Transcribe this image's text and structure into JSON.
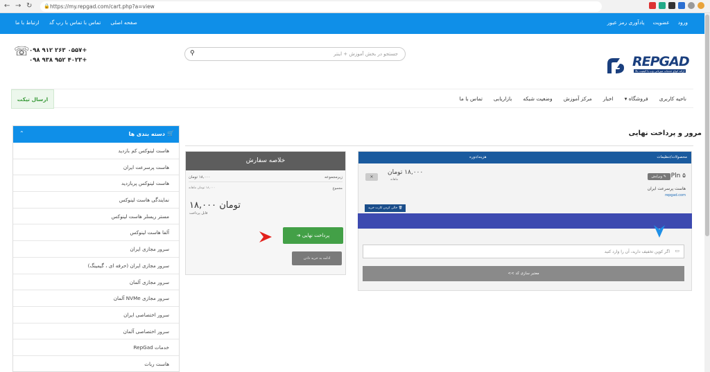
{
  "browser": {
    "url": "https://my.repgad.com/cart.php?a=view"
  },
  "topbar": {
    "left_links": [
      "صفحه اصلی",
      "تماس با تماس با رپ گد",
      "ارتباط با ما"
    ],
    "right_links": [
      "ورود",
      "عضویت",
      "یادآوری رمز عبور"
    ]
  },
  "header": {
    "phone1": "۰۹۸ ۹۱۲ ۲۶۳ ۰۵۵۷+",
    "phone2": "۰۹۸ ۹۳۸ ۹۵۲ ۴۰۲۳+",
    "search_placeholder": "جستجو در بخش آموزش + اینتر",
    "logo_text": "REPGAD",
    "logo_tagline": "ارائه انواع خدمات میزبانی وب با کیفیت بالا"
  },
  "menu": {
    "ticket": "ارسال تیکت",
    "items": [
      "ناحیه کاربری",
      "فروشگاه",
      "اخبار",
      "مرکز آموزش",
      "وضعیت شبکه",
      "بازاریابی",
      "تماس با ما"
    ]
  },
  "categories": {
    "title": "دسته بندی ها",
    "items": [
      "هاست لینوکس کم بازدید",
      "هاست پرسرعت ایران",
      "هاست لینوکس پربازدید",
      "نمایندگی هاست لینوکس",
      "مستر ریسلر هاست لینوکس",
      "آلفا هاست لینوکس",
      "سرور مجازی ایران",
      "سرور مجازی ایران (حرفه ای ، گیمینگ)",
      "سرور مجازی آلمان",
      "سرور مجازی NVMe آلمان",
      "سرور اختصاصی ایران",
      "سرور اختصاصی آلمان",
      "خدمات RepGad",
      "هاست ربات"
    ]
  },
  "page": {
    "title": "مرور و پرداخت نهایی"
  },
  "summary": {
    "title": "خلاصه سفارش",
    "subtotal_label": "زیرمجموعه",
    "subtotal_value": "۱۸,۰۰۰ تومان",
    "total_label": "مجموع",
    "total_note": "۱۸,۰۰۰ تومان ماهانه",
    "total": "۱۸,۰۰۰ تومان",
    "payable": "قابل پرداخت",
    "checkout": "پرداخت نهایی ➔",
    "continue": "ادامه به خرید دادن"
  },
  "cart": {
    "col_product": "محصولات/تنظیمات",
    "col_price": "هزینه/دوره",
    "item_name": "Pln ۵",
    "edit": "✎ ویرایش",
    "item_desc": "هاست پرسرعت ایران",
    "item_domain": "repgad.com",
    "item_price": "۱۸,۰۰۰ تومان",
    "item_cycle": "ماهانه",
    "remove": "✕",
    "empty_cart": "خالی کردن کارت خرید",
    "promo_placeholder": "اگر کوپن تخفیف دارید، آن را وارد کنید",
    "validate": "معتبر سازی کد >>"
  }
}
